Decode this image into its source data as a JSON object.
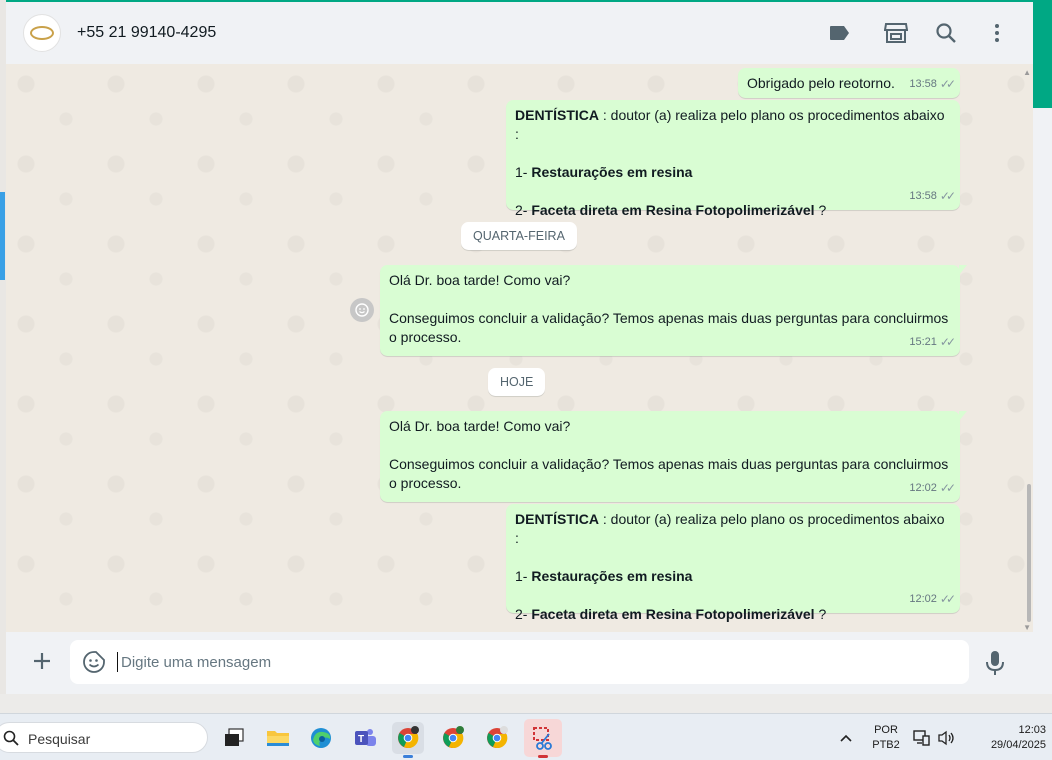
{
  "header": {
    "contact_name": "+55 21 99140-4295",
    "icons": [
      "label-icon",
      "shop-icon",
      "search-icon",
      "menu-icon"
    ]
  },
  "messages": [
    {
      "type": "out",
      "lines": [
        "Obrigado pelo reotorno."
      ],
      "time": "13:58"
    },
    {
      "type": "out",
      "bold_prefix": "DENTÍSTICA",
      "line1_rest": " : doutor (a) realiza pelo plano os procedimentos abaixo :",
      "item1_prefix": "1- ",
      "item1_bold": "Restaurações em resina",
      "item2_prefix": "2- ",
      "item2_bold": "Faceta direta em Resina Fotopolimerizável",
      "item2_suffix": " ?",
      "time": "13:58"
    },
    {
      "type": "date",
      "label": "QUARTA-FEIRA"
    },
    {
      "type": "out",
      "line1": "Olá Dr. boa tarde! Como vai?",
      "line2": "Conseguimos concluir a validação? Temos apenas mais duas perguntas para concluirmos",
      "line3": "o processo.",
      "time": "15:21"
    },
    {
      "type": "date",
      "label": "HOJE"
    },
    {
      "type": "out",
      "line1": "Olá Dr. boa tarde! Como vai?",
      "line2": "Conseguimos concluir a validação? Temos apenas mais duas perguntas para concluirmos",
      "line3": "o processo.",
      "time": "12:02"
    },
    {
      "type": "out",
      "bold_prefix": "DENTÍSTICA",
      "line1_rest": " : doutor (a) realiza pelo plano os procedimentos abaixo :",
      "item1_prefix": "1- ",
      "item1_bold": "Restaurações em resina",
      "item2_prefix": "2- ",
      "item2_bold": "Faceta direta em Resina Fotopolimerizável",
      "item2_suffix": " ?",
      "time": "12:02"
    }
  ],
  "composer": {
    "placeholder": "Digite uma mensagem"
  },
  "taskbar": {
    "search_label": "Pesquisar",
    "lang_line1": "POR",
    "lang_line2": "PTB2",
    "time": "12:03",
    "date": "29/04/2025"
  },
  "colors": {
    "accent": "#00a884",
    "outgoing_bubble": "#d9fdd3",
    "chat_bg": "#efeae2"
  }
}
